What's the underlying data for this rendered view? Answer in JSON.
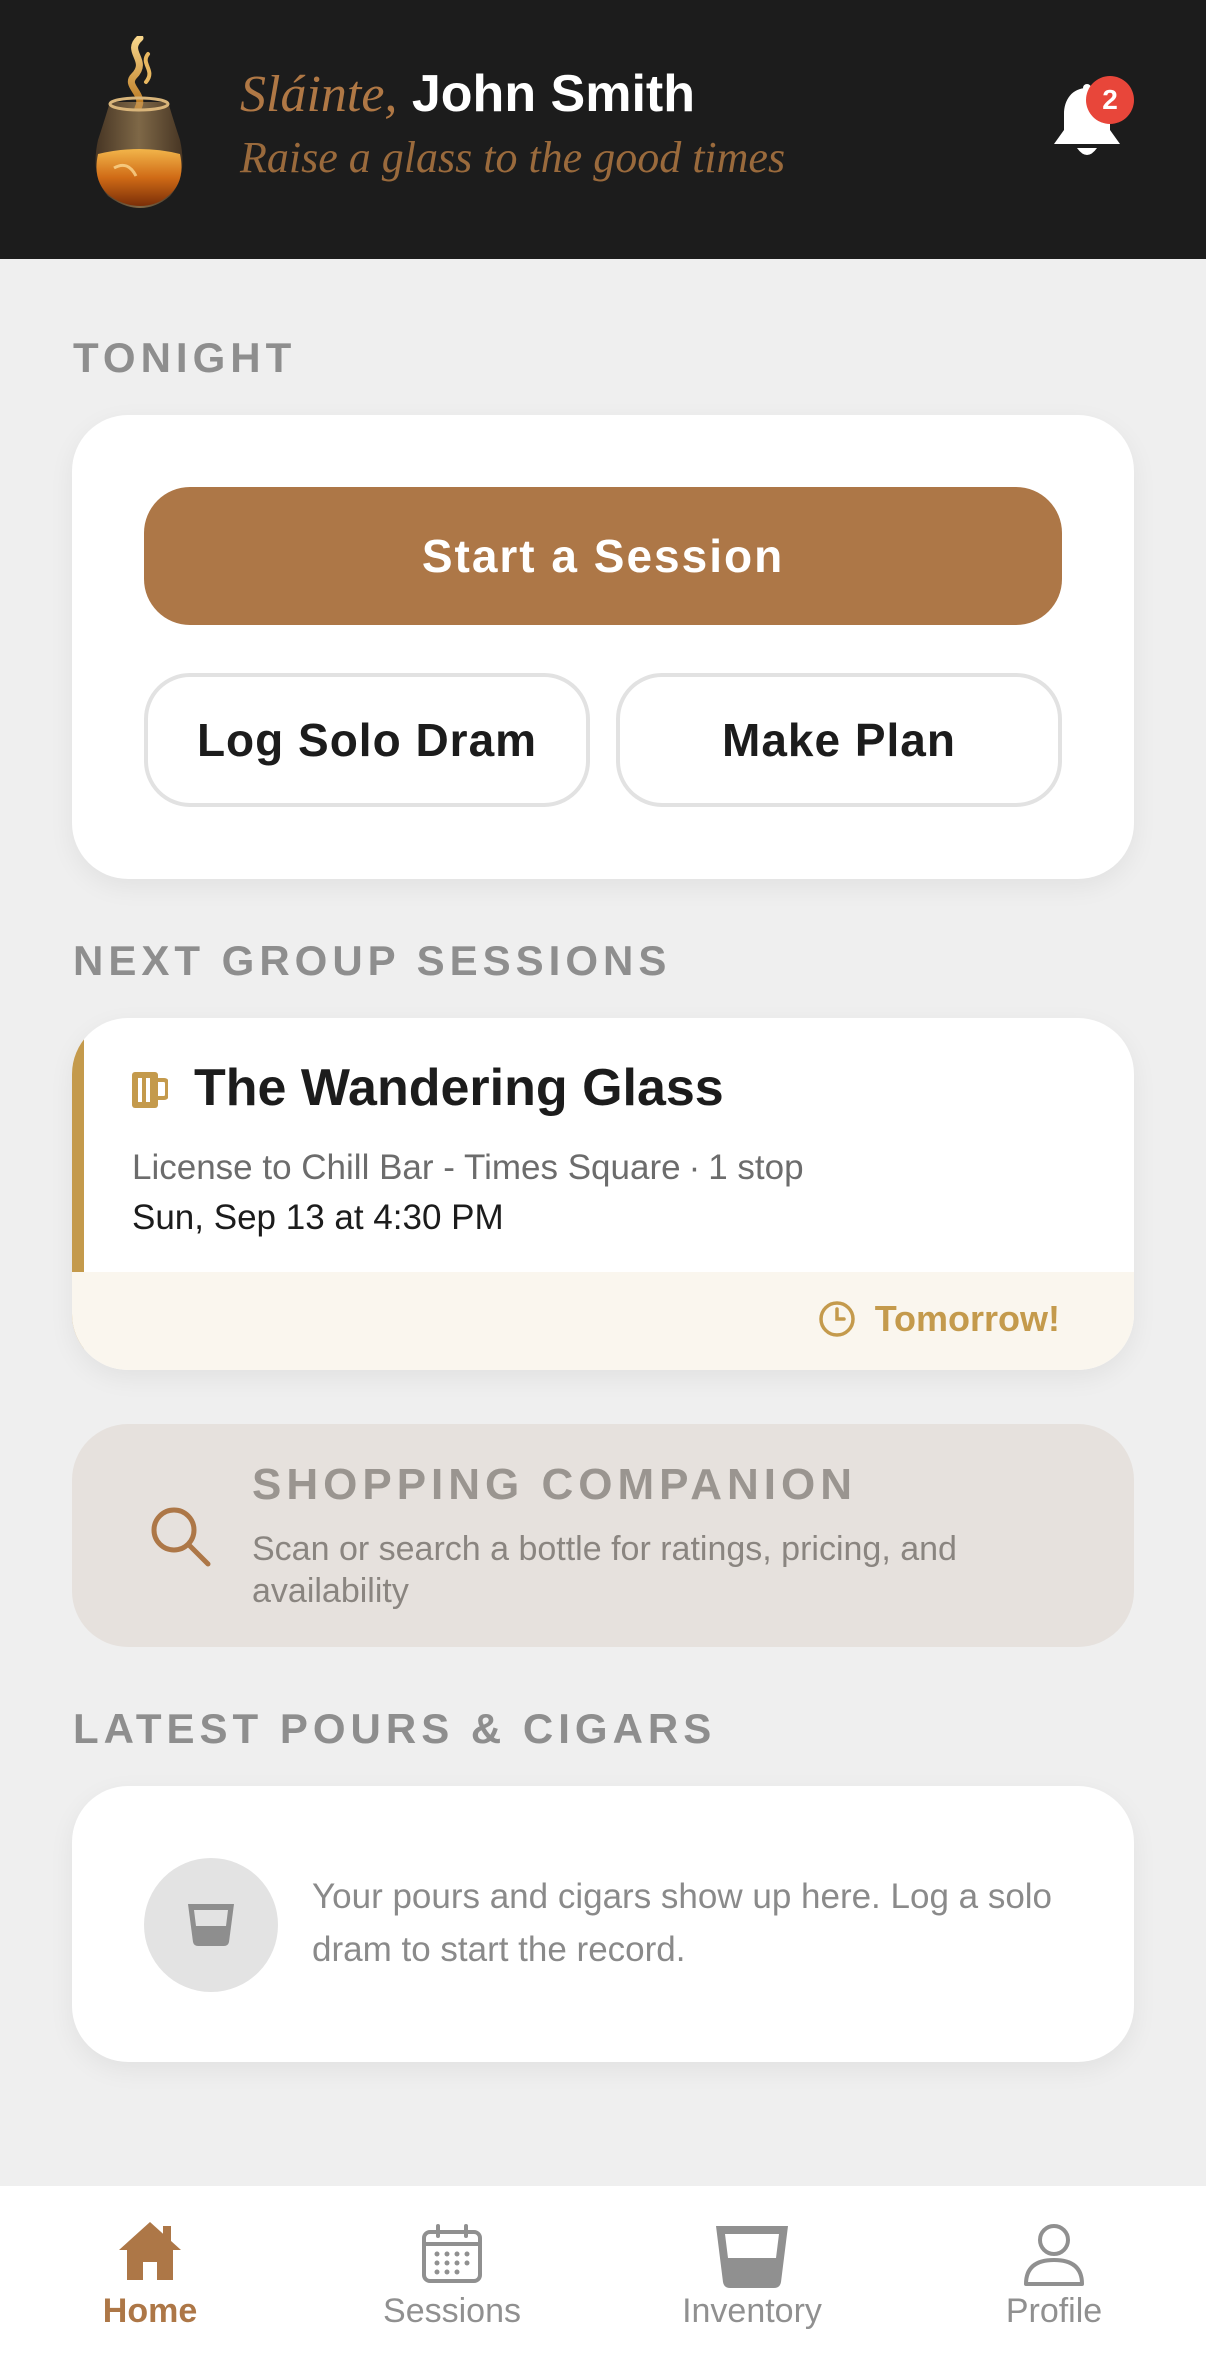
{
  "header": {
    "greeting_word": "Sláinte,",
    "user_name": "John Smith",
    "tagline": "Raise a glass to the good times",
    "notification_count": "2",
    "logo_icon": "whisky-glass-logo-icon",
    "bell_icon": "bell-icon"
  },
  "tonight": {
    "section_label": "TONIGHT",
    "start_session_label": "Start a Session",
    "log_solo_dram_label": "Log Solo Dram",
    "make_plan_label": "Make Plan"
  },
  "group_sessions": {
    "section_label": "NEXT GROUP SESSIONS",
    "items": [
      {
        "icon": "beer-mug-icon",
        "title": "The Wandering Glass",
        "venue": "License to Chill Bar - Times Square",
        "separator": "·",
        "stops": "1 stop",
        "date": "Sun, Sep 13 at 4:30 PM",
        "status_icon": "clock-icon",
        "status": "Tomorrow!"
      }
    ]
  },
  "shopping_companion": {
    "icon": "search-icon",
    "title": "SHOPPING COMPANION",
    "description": "Scan or search a bottle for ratings, pricing, and availability"
  },
  "latest_pours": {
    "section_label": "LATEST POURS & CIGARS",
    "icon": "tumbler-glass-icon",
    "empty_text": "Your pours and cigars show up here. Log a solo dram to start the record."
  },
  "bottom_nav": {
    "items": [
      {
        "label": "Home",
        "icon": "home-icon",
        "active": true
      },
      {
        "label": "Sessions",
        "icon": "calendar-icon",
        "active": false
      },
      {
        "label": "Inventory",
        "icon": "glass-icon",
        "active": false
      },
      {
        "label": "Profile",
        "icon": "person-icon",
        "active": false
      }
    ]
  },
  "colors": {
    "accent": "#ad7747",
    "gold": "#c49a4c",
    "header_bg": "#1c1c1c",
    "badge": "#e8463a",
    "page_bg": "#efefef"
  }
}
